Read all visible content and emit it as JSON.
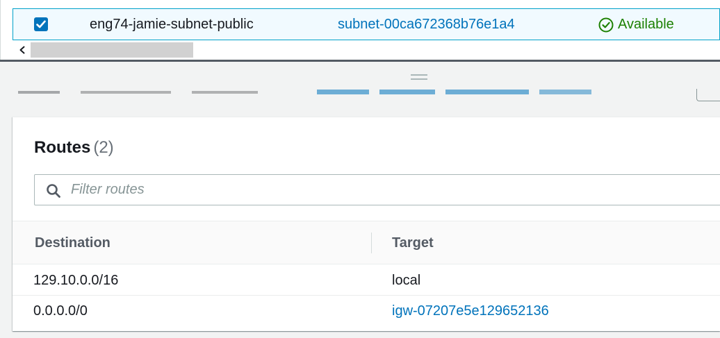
{
  "subnet_table": {
    "selected_row": {
      "checked": true,
      "name": "eng74-jamie-subnet-public",
      "subnet_id": "subnet-00ca672368b76e1a4",
      "state": "Available"
    },
    "scroll_left_glyph": "<"
  },
  "routes": {
    "title": "Routes",
    "count": "(2)",
    "filter_placeholder": "Filter routes",
    "columns": {
      "destination": "Destination",
      "target": "Target"
    },
    "rows": [
      {
        "destination": "129.10.0.0/16",
        "target": "local",
        "target_is_link": false
      },
      {
        "destination": "0.0.0.0/0",
        "target": "igw-07207e5e129652136",
        "target_is_link": true
      }
    ]
  },
  "colors": {
    "link": "#0073bb",
    "success": "#1d8102",
    "selected_row_bg": "#f1faff",
    "selected_row_border": "#00a1c9"
  },
  "icons": {
    "checkbox": "checkbox-checked-icon",
    "status": "status-success-icon",
    "filter": "search-icon",
    "scroll_left": "chevron-left-icon",
    "drag": "drag-handle-icon"
  }
}
